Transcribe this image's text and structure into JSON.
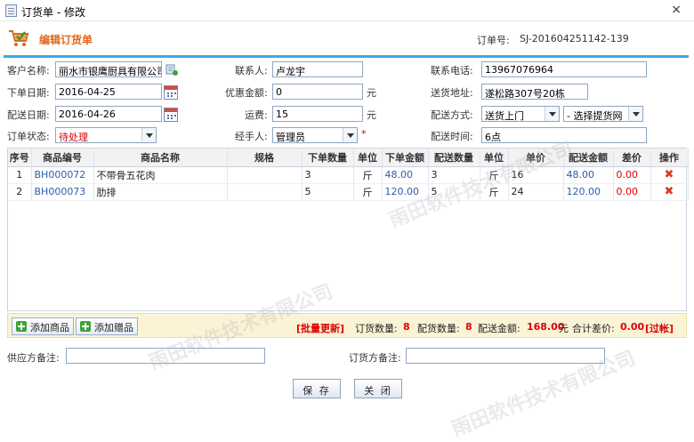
{
  "window": {
    "title": "订货单 - 修改",
    "close": "×"
  },
  "header": {
    "title": "编辑订货单",
    "order_label": "订单号:",
    "order_no": "SJ-201604251142-139"
  },
  "form": {
    "customer_label": "客户名称:",
    "customer_value": "丽水市银鹰厨具有限公司",
    "contact_label": "联系人:",
    "contact_value": "卢龙宇",
    "phone_label": "联系电话:",
    "phone_value": "13967076964",
    "order_date_label": "下单日期:",
    "order_date_value": "2016-04-25",
    "discount_label": "优惠金额:",
    "discount_value": "0",
    "discount_unit": "元",
    "address_label": "送货地址:",
    "address_value": "遂松路307号20栋",
    "delivery_date_label": "配送日期:",
    "delivery_date_value": "2016-04-26",
    "freight_label": "运费:",
    "freight_value": "15",
    "freight_unit": "元",
    "method_label": "配送方式:",
    "method_value": "送货上门",
    "pickup_value": "- 选择提货网",
    "status_label": "订单状态:",
    "status_value": "待处理",
    "handler_label": "经手人:",
    "handler_value": "管理员",
    "required_mark": "*",
    "time_label": "配送时间:",
    "time_value": "6点"
  },
  "table": {
    "headers": [
      "序号",
      "商品编号",
      "商品名称",
      "规格",
      "下单数量",
      "单位",
      "下单金额",
      "配送数量",
      "单位",
      "单价",
      "配送金额",
      "差价",
      "操作"
    ],
    "rows": [
      {
        "no": "1",
        "code": "BH000072",
        "name": "不带骨五花肉",
        "spec": "",
        "qty": "3",
        "unit": "斤",
        "amount": "48.00",
        "dqty": "3",
        "dunit": "斤",
        "price": "16",
        "damount": "48.00",
        "diff": "0.00",
        "action": "✖"
      },
      {
        "no": "2",
        "code": "BH000073",
        "name": "肋排",
        "spec": "",
        "qty": "5",
        "unit": "斤",
        "amount": "120.00",
        "dqty": "5",
        "dunit": "斤",
        "price": "24",
        "damount": "120.00",
        "diff": "0.00",
        "action": "✖"
      }
    ]
  },
  "footer": {
    "add_product": "添加商品",
    "add_gift": "添加赠品",
    "batch_update": "[批量更新]",
    "order_qty_label": "订货数量:",
    "order_qty": "8",
    "delivery_qty_label": "配货数量:",
    "delivery_qty": "8",
    "delivery_amount_label": "配送金额:",
    "delivery_amount": "168.00",
    "yuan": "元",
    "diff_label": "合计差价:",
    "diff_value": "0.00",
    "over_account": "[过帐]"
  },
  "notes": {
    "supplier_label": "供应方备注:",
    "supplier_value": "",
    "buyer_label": "订货方备注:",
    "buyer_value": ""
  },
  "buttons": {
    "save": "保 存",
    "close": "关 闭"
  },
  "watermark": "雨田软件技术有限公司"
}
